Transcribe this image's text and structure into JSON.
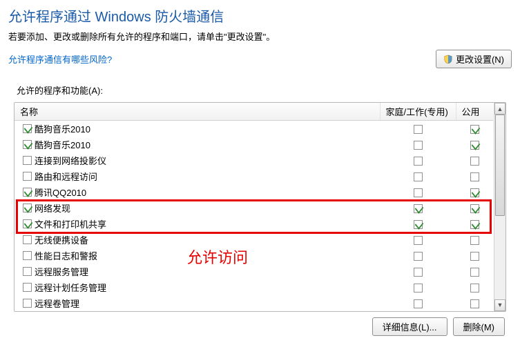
{
  "header": {
    "title": "允许程序通过 Windows 防火墙通信",
    "subtitle": "若要添加、更改或删除所有允许的程序和端口，请单击\"更改设置\"。",
    "risk_link": "允许程序通信有哪些风险?",
    "change_settings_btn": "更改设置(N)"
  },
  "panel": {
    "label": "允许的程序和功能(A):",
    "columns": {
      "name": "名称",
      "home": "家庭/工作(专用)",
      "public": "公用"
    },
    "rows": [
      {
        "name": "酷狗音乐2010",
        "enabled": true,
        "home": false,
        "pub": true
      },
      {
        "name": "酷狗音乐2010",
        "enabled": true,
        "home": false,
        "pub": true
      },
      {
        "name": "连接到网络投影仪",
        "enabled": false,
        "home": false,
        "pub": false
      },
      {
        "name": "路由和远程访问",
        "enabled": false,
        "home": false,
        "pub": false
      },
      {
        "name": "腾讯QQ2010",
        "enabled": true,
        "home": false,
        "pub": true
      },
      {
        "name": "网络发现",
        "enabled": true,
        "home": true,
        "pub": true
      },
      {
        "name": "文件和打印机共享",
        "enabled": true,
        "home": true,
        "pub": true
      },
      {
        "name": "无线便携设备",
        "enabled": false,
        "home": false,
        "pub": false
      },
      {
        "name": "性能日志和警报",
        "enabled": false,
        "home": false,
        "pub": false
      },
      {
        "name": "远程服务管理",
        "enabled": false,
        "home": false,
        "pub": false
      },
      {
        "name": "远程计划任务管理",
        "enabled": false,
        "home": false,
        "pub": false
      },
      {
        "name": "远程卷管理",
        "enabled": false,
        "home": false,
        "pub": false
      }
    ],
    "annotation": "允许访问",
    "highlight_rows": [
      5,
      6
    ]
  },
  "footer": {
    "details_btn": "详细信息(L)...",
    "delete_btn": "删除(M)"
  }
}
